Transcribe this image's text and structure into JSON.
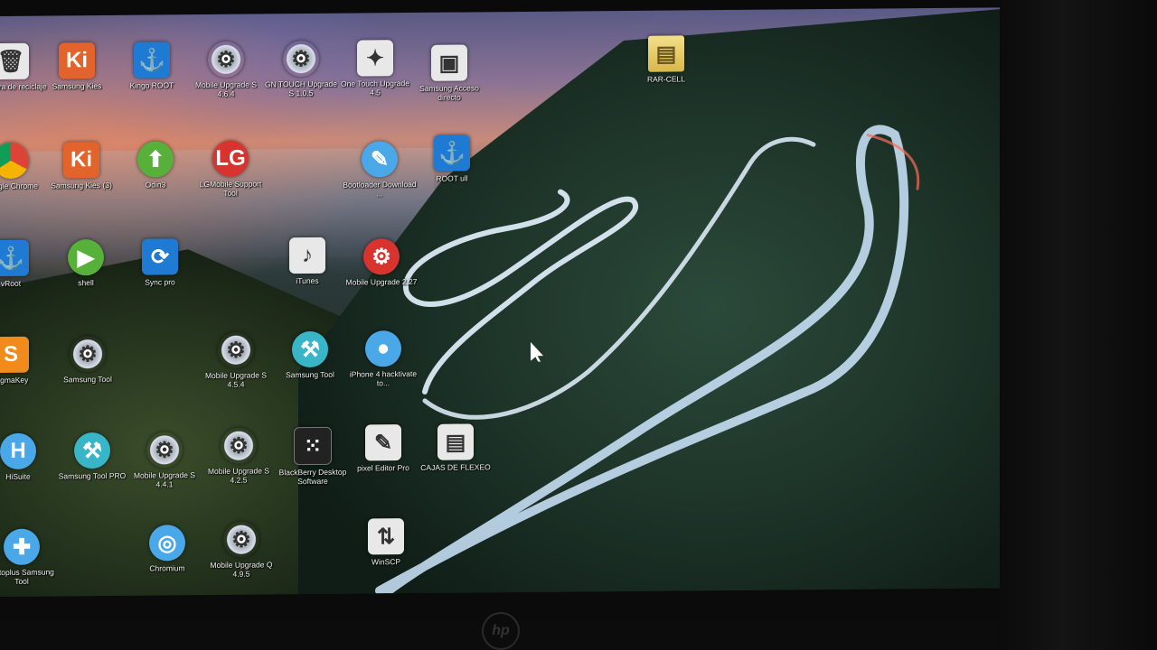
{
  "desktop": {
    "icons": [
      {
        "id": "recycle-bin",
        "glyph": "🗑",
        "style": "white",
        "label": "Papelera de reciclaje"
      },
      {
        "id": "samsung-kies",
        "glyph": "Ki",
        "style": "k",
        "label": "Samsung Kies"
      },
      {
        "id": "kingo-root",
        "glyph": "⚓",
        "style": "blue",
        "label": "Kingo ROOT"
      },
      {
        "id": "mobile-upgrade-1",
        "glyph": "⚙",
        "style": "gear",
        "label": "Mobile Upgrade S 4.6.4"
      },
      {
        "id": "gn-touch-upgrade",
        "glyph": "⚙",
        "style": "gear",
        "label": "GN TOUCH Upgrade S 1.0.5"
      },
      {
        "id": "one-touch-upgrade",
        "glyph": "✦",
        "style": "white",
        "label": "One Touch Upgrade 4.5"
      },
      {
        "id": "samsung-acceso",
        "glyph": "▣",
        "style": "white",
        "label": "Samsung Acceso directo"
      },
      {
        "id": "rar-cell",
        "glyph": "▤",
        "style": "folder",
        "label": "RAR-CELL"
      },
      {
        "id": "google-chrome",
        "glyph": "",
        "style": "chrome",
        "label": "Google Chrome"
      },
      {
        "id": "samsung-kies-3",
        "glyph": "Ki",
        "style": "k",
        "label": "Samsung Kies (3)"
      },
      {
        "id": "odin",
        "glyph": "⬆",
        "style": "green",
        "label": "Odin3"
      },
      {
        "id": "lg-mobile-support",
        "glyph": "LG",
        "style": "red",
        "label": "LGMobile Support Tool"
      },
      {
        "id": "bootloader-download",
        "glyph": "✎",
        "style": "sky",
        "label": "Bootloader Download ..."
      },
      {
        "id": "root-app",
        "glyph": "⚓",
        "style": "blue",
        "label": "ROOT ull"
      },
      {
        "id": "vroot",
        "glyph": "⚓",
        "style": "blue",
        "label": "vRoot"
      },
      {
        "id": "shell",
        "glyph": "▶",
        "style": "green",
        "label": "shell"
      },
      {
        "id": "sync-tool",
        "glyph": "⟳",
        "style": "blue",
        "label": "Sync pro"
      },
      {
        "id": "itunes",
        "glyph": "♪",
        "style": "white",
        "label": "iTunes"
      },
      {
        "id": "mobile-upgrade-227",
        "glyph": "⚙",
        "style": "red",
        "label": "Mobile Upgrade 2.27"
      },
      {
        "id": "sigmakey",
        "glyph": "S",
        "style": "orange",
        "label": "SigmaKey"
      },
      {
        "id": "samsung-tool-1",
        "glyph": "⚙",
        "style": "gear",
        "label": "Samsung Tool"
      },
      {
        "id": "mobile-upgrade-s454",
        "glyph": "⚙",
        "style": "gear",
        "label": "Mobile Upgrade S 4.5.4"
      },
      {
        "id": "samsung-tool-2",
        "glyph": "⚒",
        "style": "teal",
        "label": "Samsung Tool"
      },
      {
        "id": "iphone-hacktivate",
        "glyph": "●",
        "style": "sky",
        "label": "iPhone 4 hacktivate to..."
      },
      {
        "id": "hisuite",
        "glyph": "H",
        "style": "sky",
        "label": "HiSuite"
      },
      {
        "id": "samsung-tool-pro",
        "glyph": "⚒",
        "style": "teal",
        "label": "Samsung Tool PRO"
      },
      {
        "id": "mobile-upgrade-s441",
        "glyph": "⚙",
        "style": "gear",
        "label": "Mobile Upgrade S 4.4.1"
      },
      {
        "id": "mobile-upgrade-s425",
        "glyph": "⚙",
        "style": "gear",
        "label": "Mobile Upgrade S 4.2.5"
      },
      {
        "id": "blackberry-desktop",
        "glyph": "⁙",
        "style": "dark",
        "label": "BlackBerry Desktop Software"
      },
      {
        "id": "pixel-editor-pro",
        "glyph": "✎",
        "style": "white",
        "label": "pixel Editor Pro"
      },
      {
        "id": "cajas-de-flexeo",
        "glyph": "▤",
        "style": "white",
        "label": "CAJAS DE FLEXEO"
      },
      {
        "id": "octoplus-samsung",
        "glyph": "✚",
        "style": "sky",
        "label": "Octoplus Samsung Tool"
      },
      {
        "id": "chromium",
        "glyph": "◎",
        "style": "sky",
        "label": "Chromium"
      },
      {
        "id": "mobile-upgrade-q495",
        "glyph": "⚙",
        "style": "gear",
        "label": "Mobile Upgrade Q 4.9.5"
      },
      {
        "id": "winscp",
        "glyph": "⇅",
        "style": "white",
        "label": "WinSCP"
      }
    ]
  },
  "monitor": {
    "brand": "hp"
  }
}
